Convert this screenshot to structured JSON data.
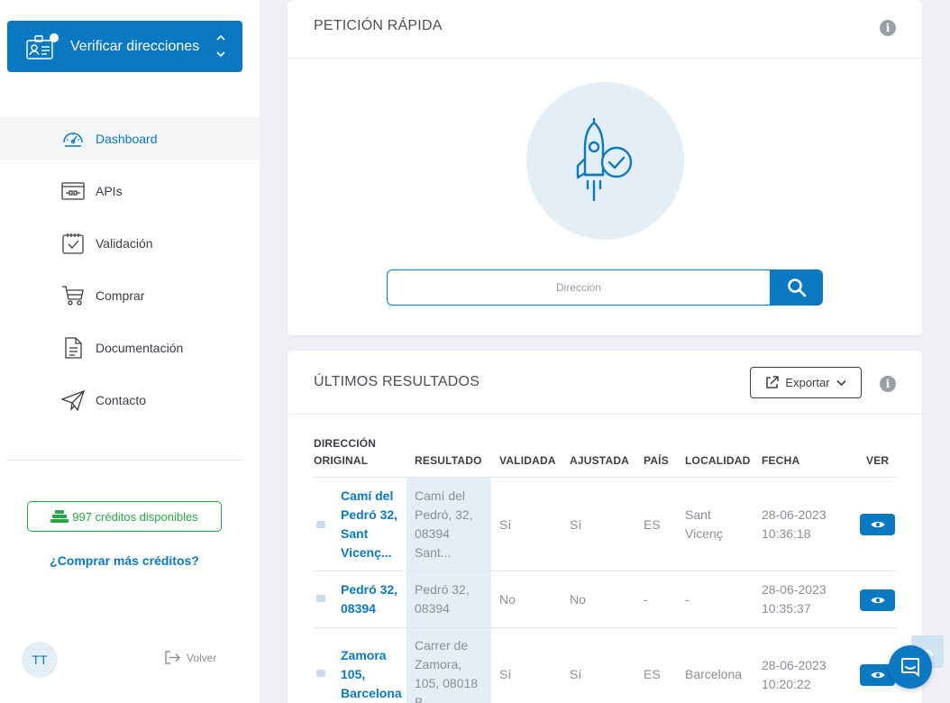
{
  "sidebar": {
    "app_title": "Verificar direcciones",
    "items": [
      {
        "label": "Dashboard",
        "icon": "dashboard-icon",
        "active": true
      },
      {
        "label": "APIs",
        "icon": "api-icon",
        "active": false
      },
      {
        "label": "Validación",
        "icon": "calendar-check-icon",
        "active": false
      },
      {
        "label": "Comprar",
        "icon": "cart-icon",
        "active": false
      },
      {
        "label": "Documentación",
        "icon": "document-icon",
        "active": false
      },
      {
        "label": "Contacto",
        "icon": "paper-plane-icon",
        "active": false
      }
    ],
    "credits": "997 créditos disponibles",
    "buy_more": "¿Comprar más créditos?",
    "avatar": "TT",
    "back": "Volver"
  },
  "quick": {
    "title": "PETICIÓN RÁPIDA",
    "placeholder": "Dirección"
  },
  "results": {
    "title": "ÚLTIMOS RESULTADOS",
    "export": "Exportar",
    "headers": {
      "original_1": "DIRECCIÓN",
      "original_2": "ORIGINAL",
      "result": "RESULTADO",
      "validated": "VALIDADA",
      "adjusted": "AJUSTADA",
      "country": "PAÍS",
      "locality": "LOCALIDAD",
      "date": "FECHA",
      "view": "VER"
    },
    "rows": [
      {
        "original": [
          "Camí del",
          "Pedró 32,",
          "Sant",
          "Vicenç..."
        ],
        "result": [
          "Camí del",
          "Pedró, 32,",
          "08394",
          "Sant..."
        ],
        "validated": "Sí",
        "adjusted": "Sí",
        "country": "ES",
        "locality": [
          "Sant",
          "Vicenç"
        ],
        "date": [
          "28-06-2023",
          "10:36:18"
        ]
      },
      {
        "original": [
          "Pedró 32,",
          "08394"
        ],
        "result": [
          "Pedró 32,",
          "08394"
        ],
        "validated": "No",
        "adjusted": "No",
        "country": "-",
        "locality": [
          "-"
        ],
        "date": [
          "28-06-2023",
          "10:35:37"
        ]
      },
      {
        "original": [
          "Zamora",
          "105,",
          "Barcelona"
        ],
        "result": [
          "Carrer de",
          "Zamora,",
          "105, 08018",
          "B..."
        ],
        "validated": "Sí",
        "adjusted": "Sí",
        "country": "ES",
        "locality": [
          "Barcelona"
        ],
        "date": [
          "28-06-2023",
          "10:20:22"
        ]
      }
    ]
  },
  "colors": {
    "primary": "#0a79c2",
    "success": "#28a745",
    "light_blue": "#e3eef7",
    "background": "#eef0f5"
  }
}
